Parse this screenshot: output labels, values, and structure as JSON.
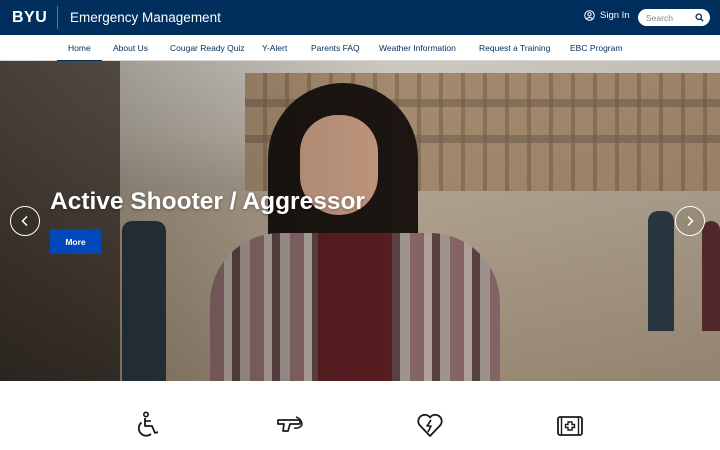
{
  "header": {
    "logo": "BYU",
    "site_title": "Emergency Management",
    "sign_in_label": "Sign In",
    "search_placeholder": "Search"
  },
  "nav": {
    "items": [
      {
        "label": "Home",
        "active": true
      },
      {
        "label": "About Us"
      },
      {
        "label": "Cougar Ready Quiz"
      },
      {
        "label": "Y-Alert"
      },
      {
        "label": "Parents FAQ"
      },
      {
        "label": "Weather Information"
      },
      {
        "label": "Request a Training"
      },
      {
        "label": "EBC Program"
      }
    ]
  },
  "hero": {
    "title": "Active Shooter / Aggressor",
    "button_label": "More"
  },
  "icons": [
    "accessibility-icon",
    "gun-icon",
    "heart-pulse-icon",
    "first-aid-kit-icon"
  ],
  "colors": {
    "header_bg": "#002e5d",
    "nav_text": "#002e5d",
    "button_bg": "#0047ba"
  }
}
